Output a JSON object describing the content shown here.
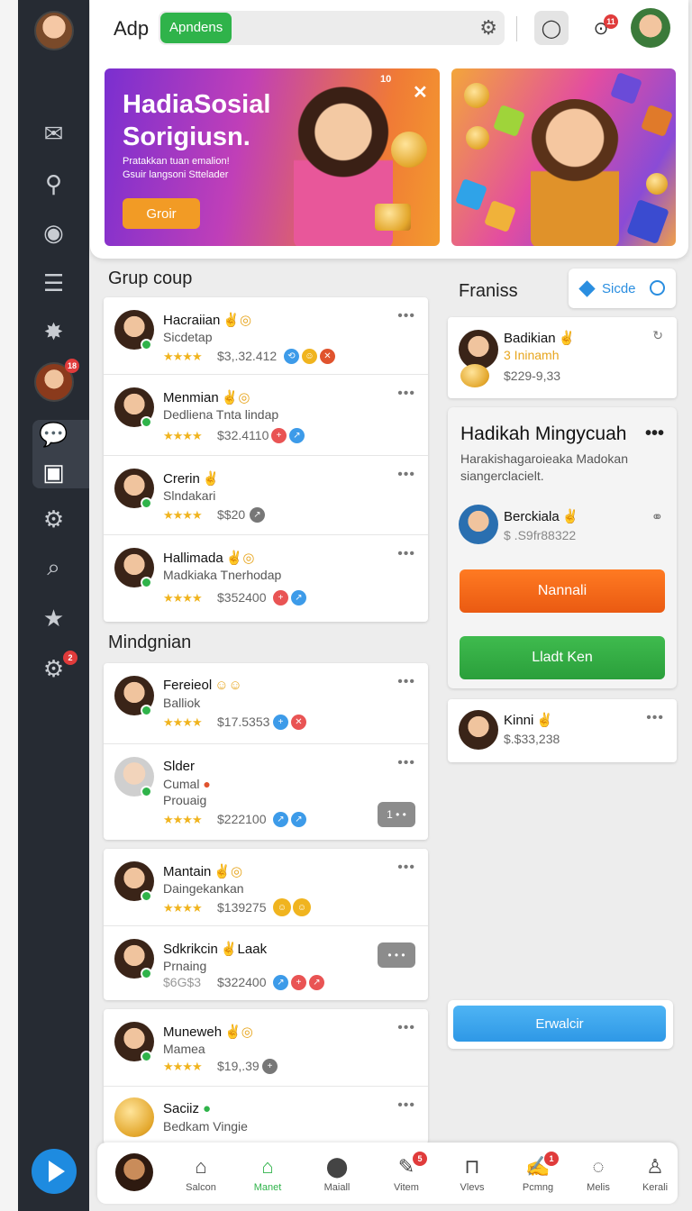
{
  "app": {
    "brand": "Adp",
    "search_tag": "Apndens"
  },
  "header": {
    "notification_count": "11"
  },
  "rail": {
    "avatar_badge": "18",
    "settings_badge": "2"
  },
  "banner_main": {
    "title": "HadiaSosial Sorigiusn.",
    "text": "Pratakkan tuan emalion! Gsuir langsoni Sttelader",
    "cta": "Groir",
    "badge": "10"
  },
  "group_section": {
    "title": "Grup coup",
    "rows": [
      {
        "name": "Hacraiian",
        "sub": "Sicdetap",
        "amount": "$3,.32.412"
      },
      {
        "name": "Menmian",
        "sub": "Dedliena Tnta lindap",
        "amount": "$32.4110"
      },
      {
        "name": "Crerin",
        "sub": "Slndakari",
        "amount": "$$20"
      },
      {
        "name": "Hallimada",
        "sub": "Madkiaka Tnerhodap",
        "amount": "$352400"
      }
    ]
  },
  "mingdnian_section": {
    "title": "Mindgnian",
    "card1": [
      {
        "name": "Fereieol",
        "sub": "Balliok",
        "amount": "$17.5353"
      },
      {
        "name": "Slder",
        "sub": "Cumal",
        "sub2": "Prouaig",
        "amount": "$222100",
        "more": "1 • •"
      }
    ],
    "card2": [
      {
        "name": "Mantain",
        "sub": "Daingekankan",
        "amount": "$139275"
      },
      {
        "name": "Sdkrikcin",
        "name_suffix": "Laak",
        "sub": "Prnaing",
        "sub2": "$6G$3",
        "amount": "$322400",
        "more": "• • •"
      }
    ],
    "card3": [
      {
        "name": "Muneweh",
        "sub": "Mamea",
        "amount": "$19,.39"
      },
      {
        "name": "Saciiz",
        "sub": "Bedkam Vingie"
      }
    ]
  },
  "right": {
    "title": "Franiss",
    "side_button": "Sicde",
    "contact1": {
      "name": "Badikian",
      "sub": "3 Ininamh",
      "amount": "$229-9,33"
    },
    "feature": {
      "title": "Hadikah Mingycuah",
      "desc": "Harakishagaroieaka Madokan siangerclacielt.",
      "contact_name": "Berckiala",
      "contact_amount": "$ .S9fr88322",
      "btn_orange": "Nannali",
      "btn_green": "Lladt Ken"
    },
    "contact2": {
      "name": "Kinni",
      "amount": "$.$33,238"
    },
    "bottom_button": "Erwalcir"
  },
  "bottom_nav": {
    "items": [
      {
        "label": "Salcon"
      },
      {
        "label": "Manet"
      },
      {
        "label": "Maiall"
      },
      {
        "label": "Vitem",
        "badge": "5"
      },
      {
        "label": "Vlevs"
      },
      {
        "label": "Pcmng",
        "badge": "1"
      },
      {
        "label": "Melis"
      },
      {
        "label": "Kerali"
      }
    ]
  },
  "colors": {
    "accent_green": "#2fb34a",
    "accent_orange": "#ea5a12",
    "accent_blue": "#2e98e6",
    "rail": "#262b33"
  }
}
